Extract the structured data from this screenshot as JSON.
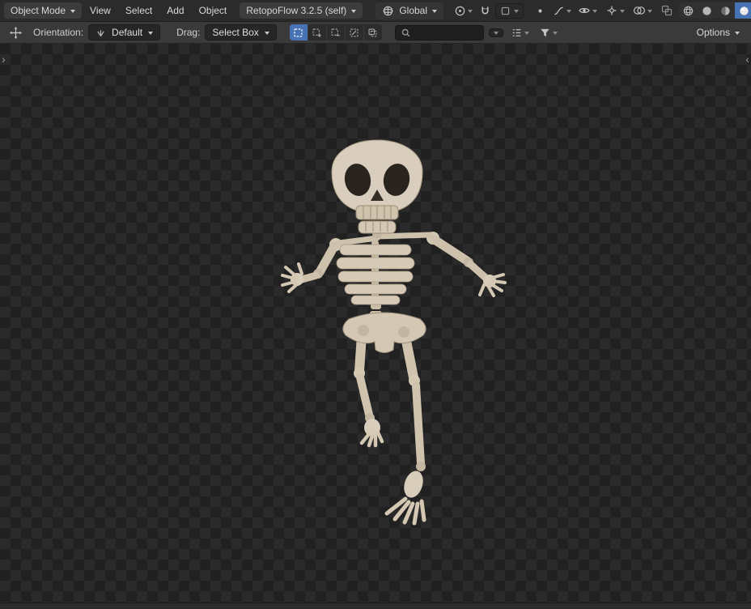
{
  "viewport_header": {
    "mode": "Object Mode",
    "menus": [
      "View",
      "Select",
      "Add",
      "Object"
    ],
    "addon_menu": "RetopoFlow 3.2.5 (self)",
    "orientation": "Global"
  },
  "tool_settings": {
    "orientation_label": "Orientation:",
    "orientation_value": "Default",
    "drag_label": "Drag:",
    "drag_value": "Select Box",
    "search_value": "",
    "options": "Options"
  },
  "viewport": {
    "toolbar_toggle": "›",
    "sidebar_toggle": "‹"
  },
  "colors": {
    "accent_blue": "#4772b3",
    "header_bg": "#2b2b2b",
    "tool_bg": "#3a3a3a",
    "checker_dark": "#212121",
    "checker_light": "#2a2a2a",
    "bone": "#d8cdbb"
  }
}
